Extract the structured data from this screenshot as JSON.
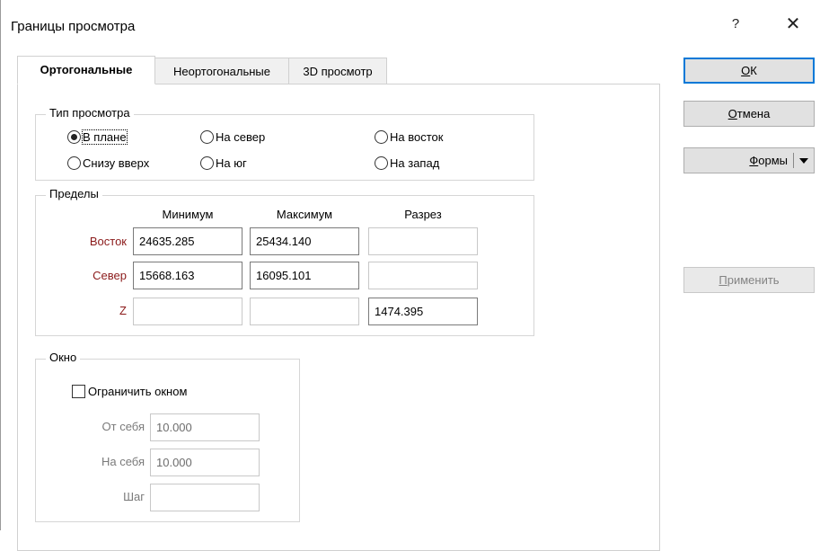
{
  "window": {
    "title": "Границы просмотра",
    "help_glyph": "?",
    "close_glyph": "✕"
  },
  "tabs": [
    {
      "label": "Ортогональные",
      "active": true
    },
    {
      "label": "Неортогональные",
      "active": false
    },
    {
      "label": "3D просмотр",
      "active": false
    }
  ],
  "view_type": {
    "label": "Тип просмотра",
    "options": [
      {
        "label": "В плане",
        "checked": true
      },
      {
        "label": "На север",
        "checked": false
      },
      {
        "label": "На восток",
        "checked": false
      },
      {
        "label": "Снизу вверх",
        "checked": false
      },
      {
        "label": "На юг",
        "checked": false
      },
      {
        "label": "На запад",
        "checked": false
      }
    ]
  },
  "limits": {
    "label": "Пределы",
    "columns": [
      "Минимум",
      "Максимум",
      "Разрез"
    ],
    "rows": [
      {
        "label": "Восток",
        "min": "24635.285",
        "max": "25434.140",
        "section": ""
      },
      {
        "label": "Север",
        "min": "15668.163",
        "max": "16095.101",
        "section": ""
      },
      {
        "label": "Z",
        "min": "",
        "max": "",
        "section": "1474.395"
      }
    ]
  },
  "window_group": {
    "label": "Окно",
    "limit_checkbox_label": "Ограничить окном",
    "limit_checked": false,
    "fields": [
      {
        "label": "От себя",
        "value": "10.000"
      },
      {
        "label": "На себя",
        "value": "10.000"
      },
      {
        "label": "Шаг",
        "value": ""
      }
    ]
  },
  "buttons": {
    "ok": {
      "underline": "О",
      "rest": "К"
    },
    "cancel": {
      "underline": "О",
      "rest": "тмена"
    },
    "forms": {
      "underline": "Ф",
      "rest": "ормы"
    },
    "apply": {
      "underline": "П",
      "rest": "рименить"
    }
  }
}
